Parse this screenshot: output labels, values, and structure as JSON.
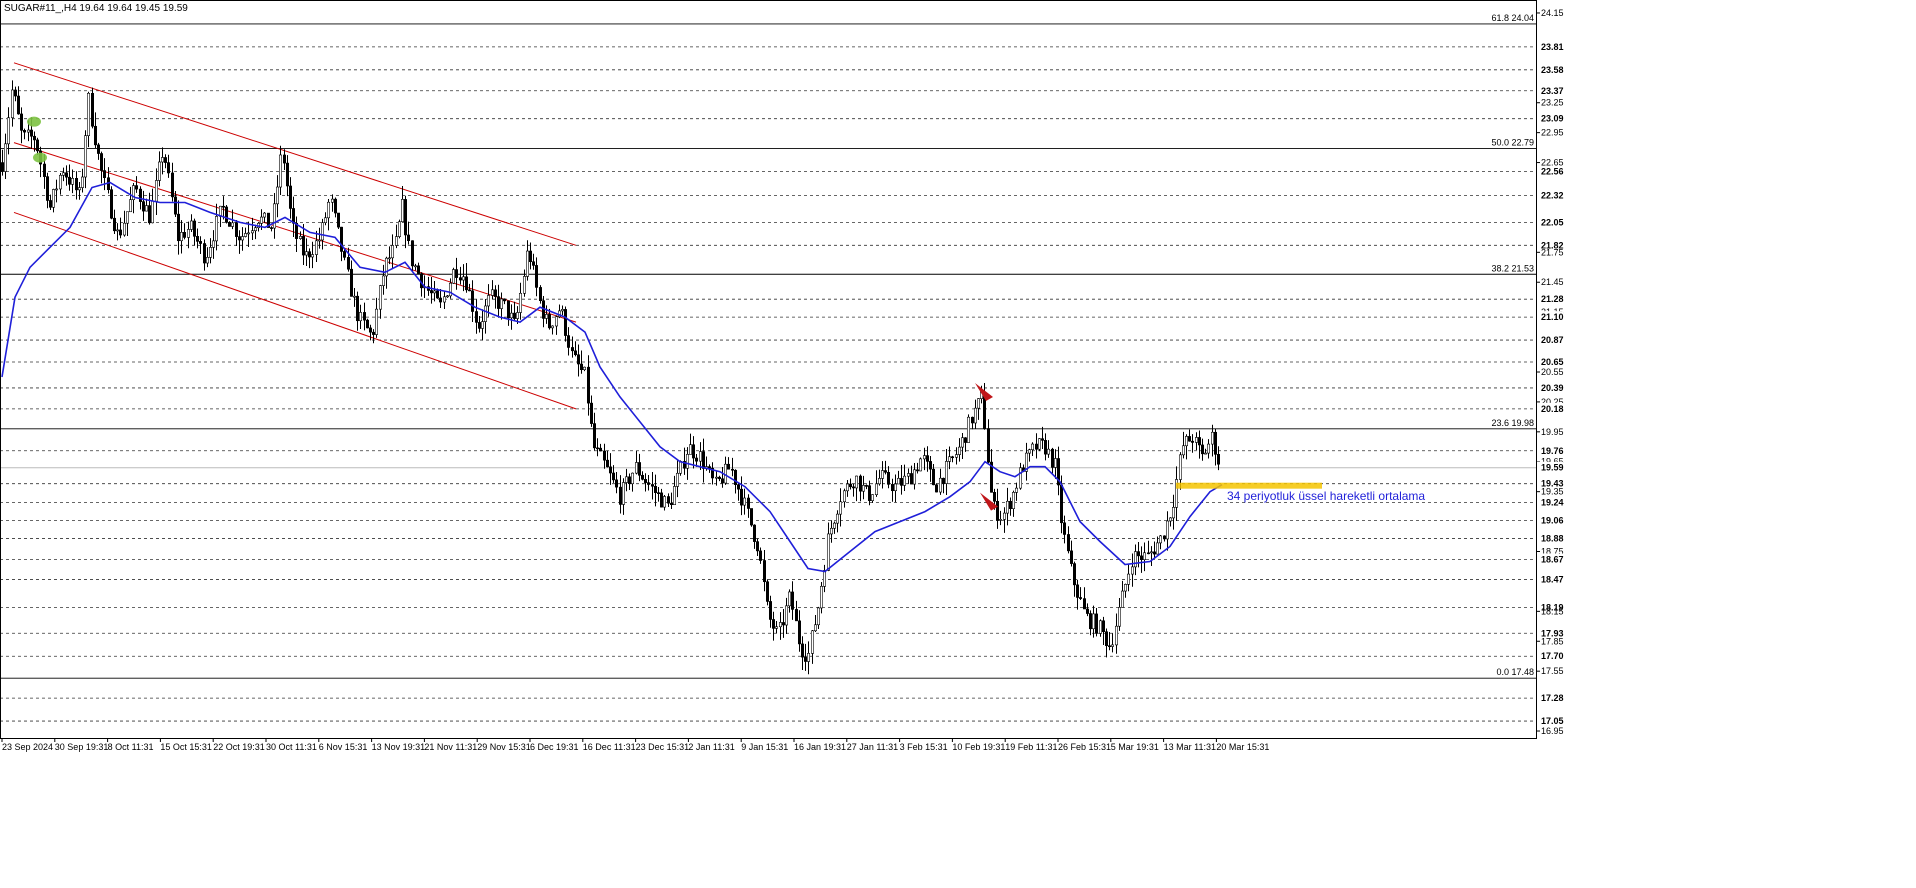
{
  "chart_data": {
    "type": "candlestick",
    "title": "SUGAR#11_,H4  19.64 19.64 19.45 19.59",
    "symbol": "SUGAR#11_,H4",
    "ohlc_last": [
      19.64,
      19.64,
      19.45,
      19.59
    ],
    "y_range": [
      16.88,
      24.28
    ],
    "y_ticks": [
      "24.15",
      "23.81",
      "23.58",
      "23.37",
      "23.25",
      "23.09",
      "22.95",
      "22.65",
      "22.56",
      "22.32",
      "22.05",
      "21.82",
      "21.75",
      "21.45",
      "21.28",
      "21.15",
      "21.10",
      "20.87",
      "20.65",
      "20.55",
      "20.39",
      "20.25",
      "20.18",
      "19.95",
      "19.76",
      "19.65",
      "19.59",
      "19.43",
      "19.35",
      "19.24",
      "19.06",
      "18.88",
      "18.75",
      "18.67",
      "18.47",
      "18.19",
      "18.15",
      "17.93",
      "17.85",
      "17.70",
      "17.55",
      "17.28",
      "17.05",
      "16.95"
    ],
    "highlight_ticks": [
      "23.81",
      "23.58",
      "23.37",
      "23.09",
      "22.56",
      "22.32",
      "22.05",
      "21.82",
      "21.28",
      "21.10",
      "20.87",
      "20.65",
      "20.39",
      "20.18",
      "19.76",
      "19.59",
      "19.43",
      "19.24",
      "19.06",
      "18.88",
      "18.67",
      "18.47",
      "18.19",
      "17.93",
      "17.70",
      "17.28",
      "17.05"
    ],
    "dashed_levels": [
      23.81,
      23.58,
      23.37,
      23.09,
      22.56,
      22.32,
      22.05,
      21.82,
      21.28,
      21.1,
      20.87,
      20.65,
      20.39,
      20.18,
      19.76,
      19.43,
      19.24,
      19.06,
      18.88,
      18.67,
      18.47,
      18.19,
      17.93,
      17.7,
      17.28,
      17.05
    ],
    "current_price": 19.59,
    "fib_levels": [
      {
        "label": "61.8 24.04",
        "value": 24.04
      },
      {
        "label": "50.0 22.79",
        "value": 22.79
      },
      {
        "label": "38.2 21.53",
        "value": 21.53
      },
      {
        "label": "23.6 19.98",
        "value": 19.98
      },
      {
        "label": "0.0 17.48",
        "value": 17.48
      }
    ],
    "x_labels": [
      "23 Sep 2024",
      "30 Sep 19:31",
      "8 Oct 11:31",
      "15 Oct 15:31",
      "22 Oct 19:31",
      "30 Oct 11:31",
      "6 Nov 15:31",
      "13 Nov 19:31",
      "21 Nov 11:31",
      "29 Nov 15:31",
      "6 Dec 19:31",
      "16 Dec 11:31",
      "23 Dec 15:31",
      "2 Jan 11:31",
      "9 Jan 15:31",
      "16 Jan 19:31",
      "27 Jan 11:31",
      "3 Feb 15:31",
      "10 Feb 19:31",
      "19 Feb 11:31",
      "26 Feb 15:31",
      "5 Mar 19:31",
      "13 Mar 11:31",
      "20 Mar 15:31"
    ],
    "price_path": [
      [
        0,
        22.5
      ],
      [
        12,
        23.4
      ],
      [
        22,
        22.9
      ],
      [
        35,
        22.9
      ],
      [
        50,
        22.2
      ],
      [
        62,
        22.6
      ],
      [
        80,
        22.3
      ],
      [
        88,
        23.3
      ],
      [
        100,
        22.6
      ],
      [
        118,
        21.9
      ],
      [
        135,
        22.4
      ],
      [
        150,
        22.1
      ],
      [
        163,
        22.8
      ],
      [
        178,
        21.9
      ],
      [
        190,
        22.0
      ],
      [
        205,
        21.7
      ],
      [
        222,
        22.2
      ],
      [
        240,
        21.9
      ],
      [
        258,
        22.1
      ],
      [
        272,
        22.0
      ],
      [
        282,
        22.8
      ],
      [
        292,
        22.0
      ],
      [
        305,
        21.7
      ],
      [
        320,
        21.9
      ],
      [
        330,
        22.3
      ],
      [
        345,
        21.6
      ],
      [
        358,
        21.1
      ],
      [
        372,
        20.9
      ],
      [
        384,
        21.6
      ],
      [
        395,
        21.8
      ],
      [
        402,
        22.2
      ],
      [
        410,
        21.7
      ],
      [
        425,
        21.4
      ],
      [
        440,
        21.2
      ],
      [
        455,
        21.6
      ],
      [
        465,
        21.5
      ],
      [
        478,
        21.0
      ],
      [
        490,
        21.3
      ],
      [
        505,
        21.2
      ],
      [
        515,
        21.0
      ],
      [
        528,
        21.8
      ],
      [
        538,
        21.3
      ],
      [
        548,
        21.0
      ],
      [
        560,
        21.2
      ],
      [
        572,
        20.7
      ],
      [
        585,
        20.5
      ],
      [
        593,
        19.8
      ],
      [
        605,
        19.6
      ],
      [
        620,
        19.3
      ],
      [
        635,
        19.6
      ],
      [
        650,
        19.4
      ],
      [
        668,
        19.2
      ],
      [
        688,
        19.8
      ],
      [
        700,
        19.7
      ],
      [
        715,
        19.4
      ],
      [
        730,
        19.6
      ],
      [
        745,
        19.2
      ],
      [
        758,
        18.8
      ],
      [
        768,
        18.1
      ],
      [
        778,
        17.9
      ],
      [
        790,
        18.3
      ],
      [
        800,
        17.8
      ],
      [
        808,
        17.7
      ],
      [
        818,
        18.2
      ],
      [
        828,
        18.9
      ],
      [
        840,
        19.3
      ],
      [
        855,
        19.5
      ],
      [
        868,
        19.3
      ],
      [
        880,
        19.5
      ],
      [
        895,
        19.4
      ],
      [
        910,
        19.5
      ],
      [
        922,
        19.7
      ],
      [
        935,
        19.4
      ],
      [
        948,
        19.6
      ],
      [
        960,
        19.8
      ],
      [
        972,
        20.1
      ],
      [
        982,
        20.3
      ],
      [
        992,
        19.2
      ],
      [
        1002,
        19.1
      ],
      [
        1012,
        19.3
      ],
      [
        1022,
        19.6
      ],
      [
        1035,
        19.8
      ],
      [
        1045,
        19.8
      ],
      [
        1055,
        19.6
      ],
      [
        1062,
        19.0
      ],
      [
        1072,
        18.5
      ],
      [
        1085,
        18.1
      ],
      [
        1098,
        18.0
      ],
      [
        1110,
        17.8
      ],
      [
        1120,
        18.2
      ],
      [
        1132,
        18.7
      ],
      [
        1148,
        18.7
      ],
      [
        1162,
        18.9
      ],
      [
        1172,
        19.2
      ],
      [
        1182,
        19.8
      ],
      [
        1192,
        19.9
      ],
      [
        1202,
        19.7
      ],
      [
        1212,
        19.9
      ],
      [
        1220,
        19.59
      ]
    ],
    "ema": {
      "label": "34 periyotluk üssel hareketli ortalama",
      "color": "#1f1fd9",
      "points": [
        [
          2,
          20.5
        ],
        [
          15,
          21.3
        ],
        [
          30,
          21.6
        ],
        [
          50,
          21.8
        ],
        [
          70,
          22.0
        ],
        [
          92,
          22.4
        ],
        [
          110,
          22.45
        ],
        [
          135,
          22.3
        ],
        [
          160,
          22.25
        ],
        [
          185,
          22.25
        ],
        [
          210,
          22.15
        ],
        [
          240,
          22.05
        ],
        [
          265,
          22.0
        ],
        [
          285,
          22.1
        ],
        [
          310,
          21.95
        ],
        [
          335,
          21.9
        ],
        [
          360,
          21.6
        ],
        [
          385,
          21.55
        ],
        [
          405,
          21.65
        ],
        [
          425,
          21.4
        ],
        [
          450,
          21.35
        ],
        [
          475,
          21.2
        ],
        [
          500,
          21.1
        ],
        [
          520,
          21.05
        ],
        [
          540,
          21.2
        ],
        [
          565,
          21.1
        ],
        [
          585,
          20.95
        ],
        [
          600,
          20.6
        ],
        [
          620,
          20.3
        ],
        [
          640,
          20.05
        ],
        [
          660,
          19.8
        ],
        [
          680,
          19.65
        ],
        [
          700,
          19.6
        ],
        [
          720,
          19.55
        ],
        [
          745,
          19.4
        ],
        [
          770,
          19.15
        ],
        [
          790,
          18.85
        ],
        [
          808,
          18.58
        ],
        [
          825,
          18.55
        ],
        [
          850,
          18.75
        ],
        [
          875,
          18.95
        ],
        [
          900,
          19.05
        ],
        [
          925,
          19.15
        ],
        [
          950,
          19.3
        ],
        [
          970,
          19.45
        ],
        [
          985,
          19.65
        ],
        [
          1000,
          19.55
        ],
        [
          1015,
          19.5
        ],
        [
          1030,
          19.6
        ],
        [
          1045,
          19.6
        ],
        [
          1060,
          19.45
        ],
        [
          1080,
          19.05
        ],
        [
          1100,
          18.85
        ],
        [
          1125,
          18.62
        ],
        [
          1150,
          18.65
        ],
        [
          1170,
          18.8
        ],
        [
          1190,
          19.1
        ],
        [
          1210,
          19.35
        ],
        [
          1222,
          19.42
        ]
      ]
    },
    "channel_lines": [
      {
        "color": "#cc0000",
        "from": [
          14,
          23.65
        ],
        "to": [
          576,
          21.82
        ]
      },
      {
        "color": "#cc0000",
        "from": [
          14,
          22.85
        ],
        "to": [
          576,
          21.05
        ]
      },
      {
        "color": "#cc0000",
        "from": [
          14,
          22.15
        ],
        "to": [
          576,
          20.18
        ]
      }
    ],
    "highlight_zone": {
      "color": "#f5c400",
      "y_top": 19.44,
      "y_bottom": 19.38,
      "x_from": 1176,
      "x_to": 1322
    },
    "markers": [
      {
        "color": "#7dc242",
        "x": 34,
        "y": 23.06
      },
      {
        "color": "#7dc242",
        "x": 40,
        "y": 22.7
      },
      {
        "color": "#c0161a",
        "x": 983,
        "y": 20.35
      },
      {
        "color": "#c0161a",
        "x": 988,
        "y": 19.25
      }
    ]
  }
}
